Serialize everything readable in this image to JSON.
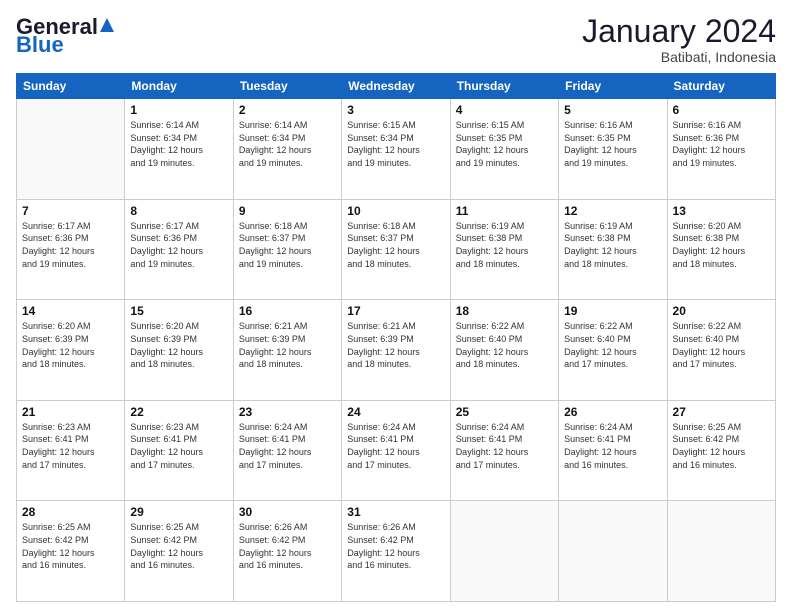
{
  "header": {
    "logo_general": "General",
    "logo_blue": "Blue",
    "month_year": "January 2024",
    "location": "Batibati, Indonesia"
  },
  "days_of_week": [
    "Sunday",
    "Monday",
    "Tuesday",
    "Wednesday",
    "Thursday",
    "Friday",
    "Saturday"
  ],
  "weeks": [
    [
      {
        "day": "",
        "content": ""
      },
      {
        "day": "1",
        "content": "Sunrise: 6:14 AM\nSunset: 6:34 PM\nDaylight: 12 hours\nand 19 minutes."
      },
      {
        "day": "2",
        "content": "Sunrise: 6:14 AM\nSunset: 6:34 PM\nDaylight: 12 hours\nand 19 minutes."
      },
      {
        "day": "3",
        "content": "Sunrise: 6:15 AM\nSunset: 6:34 PM\nDaylight: 12 hours\nand 19 minutes."
      },
      {
        "day": "4",
        "content": "Sunrise: 6:15 AM\nSunset: 6:35 PM\nDaylight: 12 hours\nand 19 minutes."
      },
      {
        "day": "5",
        "content": "Sunrise: 6:16 AM\nSunset: 6:35 PM\nDaylight: 12 hours\nand 19 minutes."
      },
      {
        "day": "6",
        "content": "Sunrise: 6:16 AM\nSunset: 6:36 PM\nDaylight: 12 hours\nand 19 minutes."
      }
    ],
    [
      {
        "day": "7",
        "content": "Sunrise: 6:17 AM\nSunset: 6:36 PM\nDaylight: 12 hours\nand 19 minutes."
      },
      {
        "day": "8",
        "content": "Sunrise: 6:17 AM\nSunset: 6:36 PM\nDaylight: 12 hours\nand 19 minutes."
      },
      {
        "day": "9",
        "content": "Sunrise: 6:18 AM\nSunset: 6:37 PM\nDaylight: 12 hours\nand 19 minutes."
      },
      {
        "day": "10",
        "content": "Sunrise: 6:18 AM\nSunset: 6:37 PM\nDaylight: 12 hours\nand 18 minutes."
      },
      {
        "day": "11",
        "content": "Sunrise: 6:19 AM\nSunset: 6:38 PM\nDaylight: 12 hours\nand 18 minutes."
      },
      {
        "day": "12",
        "content": "Sunrise: 6:19 AM\nSunset: 6:38 PM\nDaylight: 12 hours\nand 18 minutes."
      },
      {
        "day": "13",
        "content": "Sunrise: 6:20 AM\nSunset: 6:38 PM\nDaylight: 12 hours\nand 18 minutes."
      }
    ],
    [
      {
        "day": "14",
        "content": "Sunrise: 6:20 AM\nSunset: 6:39 PM\nDaylight: 12 hours\nand 18 minutes."
      },
      {
        "day": "15",
        "content": "Sunrise: 6:20 AM\nSunset: 6:39 PM\nDaylight: 12 hours\nand 18 minutes."
      },
      {
        "day": "16",
        "content": "Sunrise: 6:21 AM\nSunset: 6:39 PM\nDaylight: 12 hours\nand 18 minutes."
      },
      {
        "day": "17",
        "content": "Sunrise: 6:21 AM\nSunset: 6:39 PM\nDaylight: 12 hours\nand 18 minutes."
      },
      {
        "day": "18",
        "content": "Sunrise: 6:22 AM\nSunset: 6:40 PM\nDaylight: 12 hours\nand 18 minutes."
      },
      {
        "day": "19",
        "content": "Sunrise: 6:22 AM\nSunset: 6:40 PM\nDaylight: 12 hours\nand 17 minutes."
      },
      {
        "day": "20",
        "content": "Sunrise: 6:22 AM\nSunset: 6:40 PM\nDaylight: 12 hours\nand 17 minutes."
      }
    ],
    [
      {
        "day": "21",
        "content": "Sunrise: 6:23 AM\nSunset: 6:41 PM\nDaylight: 12 hours\nand 17 minutes."
      },
      {
        "day": "22",
        "content": "Sunrise: 6:23 AM\nSunset: 6:41 PM\nDaylight: 12 hours\nand 17 minutes."
      },
      {
        "day": "23",
        "content": "Sunrise: 6:24 AM\nSunset: 6:41 PM\nDaylight: 12 hours\nand 17 minutes."
      },
      {
        "day": "24",
        "content": "Sunrise: 6:24 AM\nSunset: 6:41 PM\nDaylight: 12 hours\nand 17 minutes."
      },
      {
        "day": "25",
        "content": "Sunrise: 6:24 AM\nSunset: 6:41 PM\nDaylight: 12 hours\nand 17 minutes."
      },
      {
        "day": "26",
        "content": "Sunrise: 6:24 AM\nSunset: 6:41 PM\nDaylight: 12 hours\nand 16 minutes."
      },
      {
        "day": "27",
        "content": "Sunrise: 6:25 AM\nSunset: 6:42 PM\nDaylight: 12 hours\nand 16 minutes."
      }
    ],
    [
      {
        "day": "28",
        "content": "Sunrise: 6:25 AM\nSunset: 6:42 PM\nDaylight: 12 hours\nand 16 minutes."
      },
      {
        "day": "29",
        "content": "Sunrise: 6:25 AM\nSunset: 6:42 PM\nDaylight: 12 hours\nand 16 minutes."
      },
      {
        "day": "30",
        "content": "Sunrise: 6:26 AM\nSunset: 6:42 PM\nDaylight: 12 hours\nand 16 minutes."
      },
      {
        "day": "31",
        "content": "Sunrise: 6:26 AM\nSunset: 6:42 PM\nDaylight: 12 hours\nand 16 minutes."
      },
      {
        "day": "",
        "content": ""
      },
      {
        "day": "",
        "content": ""
      },
      {
        "day": "",
        "content": ""
      }
    ]
  ]
}
